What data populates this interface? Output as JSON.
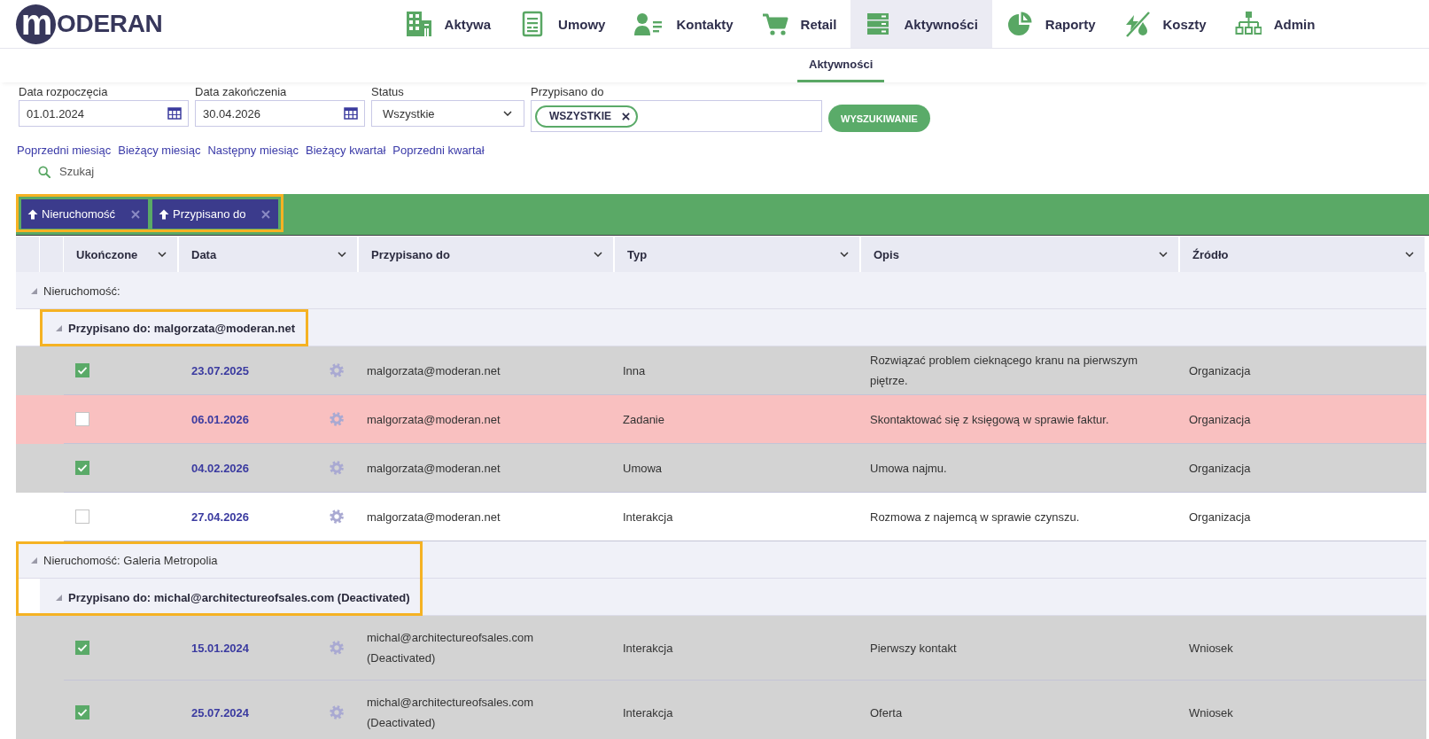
{
  "header": {
    "logo": {
      "mark": "m",
      "text": "ODERAN"
    },
    "nav": [
      {
        "kind": "building",
        "label": "Aktywa",
        "selected": false
      },
      {
        "kind": "document",
        "label": "Umowy",
        "selected": false
      },
      {
        "kind": "contacts",
        "label": "Kontakty",
        "selected": false
      },
      {
        "kind": "cart",
        "label": "Retail",
        "selected": false
      },
      {
        "kind": "list",
        "label": "Aktywności",
        "selected": true
      },
      {
        "kind": "pie",
        "label": "Raporty",
        "selected": false
      },
      {
        "kind": "costs",
        "label": "Koszty",
        "selected": false
      },
      {
        "kind": "hierarchy",
        "label": "Admin",
        "selected": false
      }
    ]
  },
  "subnav": {
    "tabs": [
      {
        "label": "Aktywności",
        "selected": true
      }
    ]
  },
  "filters": {
    "fields": [
      {
        "kind": "date",
        "label": "Data rozpoczęcia",
        "value": "01.01.2024"
      },
      {
        "kind": "date",
        "label": "Data zakończenia",
        "value": "30.04.2026"
      },
      {
        "kind": "select",
        "label": "Status",
        "value": "Wszystkie"
      },
      {
        "kind": "tags",
        "label": "Przypisano do",
        "tags": [
          "WSZYSTKIE"
        ]
      }
    ],
    "search_button": "WYSZUKIWANIE",
    "quick_ranges": [
      "Poprzedni miesiąc",
      "Bieżący miesiąc",
      "Następny miesiąc",
      "Bieżący kwartał",
      "Poprzedni kwartał"
    ],
    "search_link": "Szukaj"
  },
  "grouping": {
    "highlighted": true,
    "chips": [
      {
        "label": "Nieruchomość"
      },
      {
        "label": "Przypisano do"
      }
    ]
  },
  "table": {
    "columns": [
      {
        "label": "Ukończone"
      },
      {
        "label": "Data"
      },
      {
        "label": "Przypisano do"
      },
      {
        "label": "Typ"
      },
      {
        "label": "Opis"
      },
      {
        "label": "Źródło"
      }
    ],
    "groups": [
      {
        "label": "Nieruchomość:",
        "highlighted": false,
        "children": [
          {
            "label": "Przypisano do: malgorzata@moderan.net",
            "highlighted": true,
            "rows": [
              {
                "kind": "done",
                "completed": true,
                "date": "23.07.2025",
                "assignee": "malgorzata@moderan.net",
                "type": "Inna",
                "description": "Rozwiązać problem cieknącego kranu na pierwszym piętrze.",
                "source": "Organizacja"
              },
              {
                "kind": "overdue",
                "completed": false,
                "date": "06.01.2026",
                "assignee": "malgorzata@moderan.net",
                "type": "Zadanie",
                "description": "Skontaktować się z księgową w sprawie faktur.",
                "source": "Organizacja"
              },
              {
                "kind": "done",
                "completed": true,
                "date": "04.02.2026",
                "assignee": "malgorzata@moderan.net",
                "type": "Umowa",
                "description": "Umowa najmu.",
                "source": "Organizacja"
              },
              {
                "kind": "open",
                "completed": false,
                "date": "27.04.2026",
                "assignee": "malgorzata@moderan.net",
                "type": "Interakcja",
                "description": "Rozmowa z najemcą w sprawie czynszu.",
                "source": "Organizacja"
              }
            ]
          }
        ]
      },
      {
        "label": "Nieruchomość: Galeria Metropolia",
        "highlighted": true,
        "children": [
          {
            "label": "Przypisano do: michal@architectureofsales.com (Deactivated)",
            "highlighted": false,
            "rows": [
              {
                "kind": "done",
                "completed": true,
                "date": "15.01.2024",
                "assignee": "michal@architectureofsales.com (Deactivated)",
                "type": "Interakcja",
                "description": "Pierwszy kontakt",
                "source": "Wniosek"
              },
              {
                "kind": "done",
                "completed": true,
                "date": "25.07.2024",
                "assignee": "michal@architectureofsales.com (Deactivated)",
                "type": "Interakcja",
                "description": "Oferta",
                "source": "Wniosek"
              }
            ]
          }
        ]
      }
    ]
  }
}
